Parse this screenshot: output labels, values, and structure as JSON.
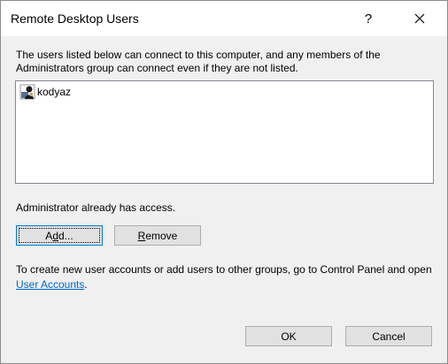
{
  "dialog": {
    "title": "Remote Desktop Users",
    "help_label": "?",
    "intro_text": "The users listed below can connect to this computer, and any members of the Administrators group can connect even if they are not listed.",
    "users": [
      {
        "name": "kodyaz",
        "icon": "user-icon"
      }
    ],
    "access_note": "Administrator already has access.",
    "add_button": {
      "before": "A",
      "mnemonic": "d",
      "after": "d..."
    },
    "remove_button": {
      "mnemonic": "R",
      "after": "emove"
    },
    "info_text_before": "To create new user accounts or add users to other groups, go to Control Panel and open ",
    "info_link": "User Accounts",
    "info_text_after": ".",
    "ok_label": "OK",
    "cancel_label": "Cancel"
  },
  "colors": {
    "link": "#0066cc",
    "focus_border": "#0078d7",
    "dialog_bg": "#f0f0f0"
  }
}
